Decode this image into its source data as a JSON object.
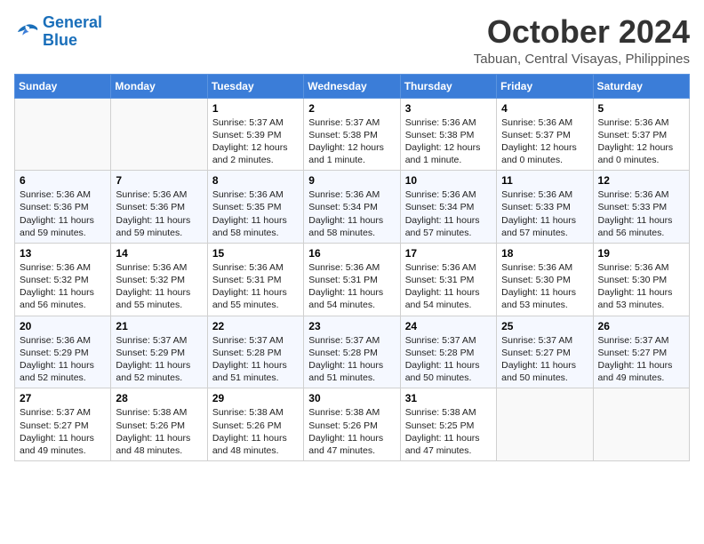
{
  "header": {
    "logo_line1": "General",
    "logo_line2": "Blue",
    "month": "October 2024",
    "location": "Tabuan, Central Visayas, Philippines"
  },
  "weekdays": [
    "Sunday",
    "Monday",
    "Tuesday",
    "Wednesday",
    "Thursday",
    "Friday",
    "Saturday"
  ],
  "weeks": [
    [
      {
        "day": "",
        "text": ""
      },
      {
        "day": "",
        "text": ""
      },
      {
        "day": "1",
        "text": "Sunrise: 5:37 AM\nSunset: 5:39 PM\nDaylight: 12 hours\nand 2 minutes."
      },
      {
        "day": "2",
        "text": "Sunrise: 5:37 AM\nSunset: 5:38 PM\nDaylight: 12 hours\nand 1 minute."
      },
      {
        "day": "3",
        "text": "Sunrise: 5:36 AM\nSunset: 5:38 PM\nDaylight: 12 hours\nand 1 minute."
      },
      {
        "day": "4",
        "text": "Sunrise: 5:36 AM\nSunset: 5:37 PM\nDaylight: 12 hours\nand 0 minutes."
      },
      {
        "day": "5",
        "text": "Sunrise: 5:36 AM\nSunset: 5:37 PM\nDaylight: 12 hours\nand 0 minutes."
      }
    ],
    [
      {
        "day": "6",
        "text": "Sunrise: 5:36 AM\nSunset: 5:36 PM\nDaylight: 11 hours\nand 59 minutes."
      },
      {
        "day": "7",
        "text": "Sunrise: 5:36 AM\nSunset: 5:36 PM\nDaylight: 11 hours\nand 59 minutes."
      },
      {
        "day": "8",
        "text": "Sunrise: 5:36 AM\nSunset: 5:35 PM\nDaylight: 11 hours\nand 58 minutes."
      },
      {
        "day": "9",
        "text": "Sunrise: 5:36 AM\nSunset: 5:34 PM\nDaylight: 11 hours\nand 58 minutes."
      },
      {
        "day": "10",
        "text": "Sunrise: 5:36 AM\nSunset: 5:34 PM\nDaylight: 11 hours\nand 57 minutes."
      },
      {
        "day": "11",
        "text": "Sunrise: 5:36 AM\nSunset: 5:33 PM\nDaylight: 11 hours\nand 57 minutes."
      },
      {
        "day": "12",
        "text": "Sunrise: 5:36 AM\nSunset: 5:33 PM\nDaylight: 11 hours\nand 56 minutes."
      }
    ],
    [
      {
        "day": "13",
        "text": "Sunrise: 5:36 AM\nSunset: 5:32 PM\nDaylight: 11 hours\nand 56 minutes."
      },
      {
        "day": "14",
        "text": "Sunrise: 5:36 AM\nSunset: 5:32 PM\nDaylight: 11 hours\nand 55 minutes."
      },
      {
        "day": "15",
        "text": "Sunrise: 5:36 AM\nSunset: 5:31 PM\nDaylight: 11 hours\nand 55 minutes."
      },
      {
        "day": "16",
        "text": "Sunrise: 5:36 AM\nSunset: 5:31 PM\nDaylight: 11 hours\nand 54 minutes."
      },
      {
        "day": "17",
        "text": "Sunrise: 5:36 AM\nSunset: 5:31 PM\nDaylight: 11 hours\nand 54 minutes."
      },
      {
        "day": "18",
        "text": "Sunrise: 5:36 AM\nSunset: 5:30 PM\nDaylight: 11 hours\nand 53 minutes."
      },
      {
        "day": "19",
        "text": "Sunrise: 5:36 AM\nSunset: 5:30 PM\nDaylight: 11 hours\nand 53 minutes."
      }
    ],
    [
      {
        "day": "20",
        "text": "Sunrise: 5:36 AM\nSunset: 5:29 PM\nDaylight: 11 hours\nand 52 minutes."
      },
      {
        "day": "21",
        "text": "Sunrise: 5:37 AM\nSunset: 5:29 PM\nDaylight: 11 hours\nand 52 minutes."
      },
      {
        "day": "22",
        "text": "Sunrise: 5:37 AM\nSunset: 5:28 PM\nDaylight: 11 hours\nand 51 minutes."
      },
      {
        "day": "23",
        "text": "Sunrise: 5:37 AM\nSunset: 5:28 PM\nDaylight: 11 hours\nand 51 minutes."
      },
      {
        "day": "24",
        "text": "Sunrise: 5:37 AM\nSunset: 5:28 PM\nDaylight: 11 hours\nand 50 minutes."
      },
      {
        "day": "25",
        "text": "Sunrise: 5:37 AM\nSunset: 5:27 PM\nDaylight: 11 hours\nand 50 minutes."
      },
      {
        "day": "26",
        "text": "Sunrise: 5:37 AM\nSunset: 5:27 PM\nDaylight: 11 hours\nand 49 minutes."
      }
    ],
    [
      {
        "day": "27",
        "text": "Sunrise: 5:37 AM\nSunset: 5:27 PM\nDaylight: 11 hours\nand 49 minutes."
      },
      {
        "day": "28",
        "text": "Sunrise: 5:38 AM\nSunset: 5:26 PM\nDaylight: 11 hours\nand 48 minutes."
      },
      {
        "day": "29",
        "text": "Sunrise: 5:38 AM\nSunset: 5:26 PM\nDaylight: 11 hours\nand 48 minutes."
      },
      {
        "day": "30",
        "text": "Sunrise: 5:38 AM\nSunset: 5:26 PM\nDaylight: 11 hours\nand 47 minutes."
      },
      {
        "day": "31",
        "text": "Sunrise: 5:38 AM\nSunset: 5:25 PM\nDaylight: 11 hours\nand 47 minutes."
      },
      {
        "day": "",
        "text": ""
      },
      {
        "day": "",
        "text": ""
      }
    ]
  ]
}
